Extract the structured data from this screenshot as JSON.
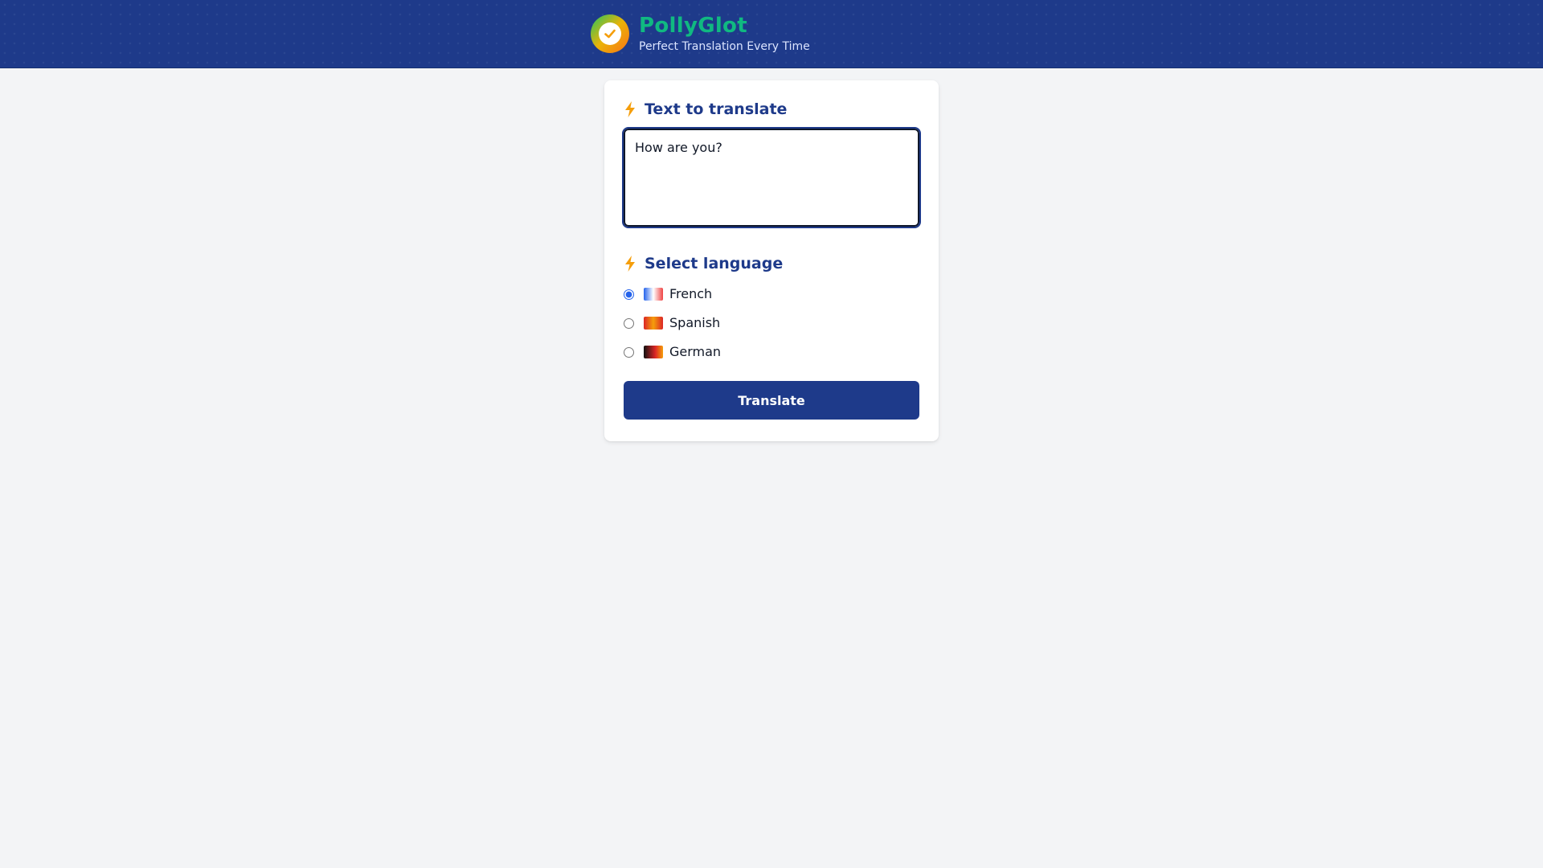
{
  "header": {
    "title": "PollyGlot",
    "tagline": "Perfect Translation Every Time",
    "logo_icon": "check-circle-icon",
    "bg_color": "#1e3a8a",
    "title_color": "#10b981"
  },
  "form": {
    "text_section_label": "Text to translate",
    "text_section_icon": "lightning-bolt-icon",
    "input_value": "How are you?",
    "language_section_label": "Select language",
    "language_section_icon": "lightning-bolt-icon",
    "languages": [
      {
        "label": "French",
        "selected": true,
        "flag_icon": "flag-france-icon"
      },
      {
        "label": "Spanish",
        "selected": false,
        "flag_icon": "flag-spain-icon"
      },
      {
        "label": "German",
        "selected": false,
        "flag_icon": "flag-germany-icon"
      }
    ],
    "submit_label": "Translate",
    "accent_color": "#1e3a8a",
    "bolt_color": "#f59e0b"
  }
}
